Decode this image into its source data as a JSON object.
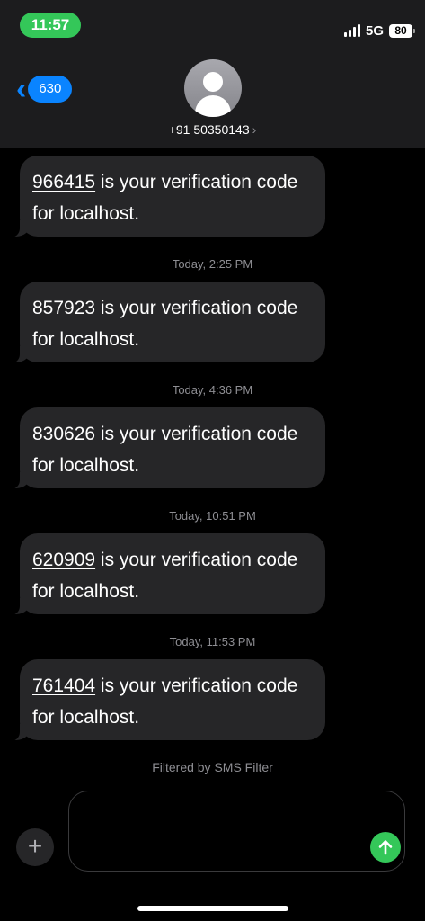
{
  "status_bar": {
    "time": "11:57",
    "network": "5G",
    "battery": "80"
  },
  "header": {
    "back_count": "630",
    "contact": "+91 50350143",
    "chevron": "›"
  },
  "messages": [
    {
      "code": "966415",
      "text": " is your verification code for localhost."
    },
    {
      "code": "857923",
      "text": " is your verification code for localhost."
    },
    {
      "code": "830626",
      "text": " is your verification code for localhost."
    },
    {
      "code": "620909",
      "text": " is your verification code for localhost."
    },
    {
      "code": "761404",
      "text": " is your verification code for localhost."
    }
  ],
  "timestamps": [
    "Today, 2:25 PM",
    "Today, 4:36 PM",
    "Today, 10:51 PM",
    "Today, 11:53 PM"
  ],
  "filter_note": "Filtered by SMS Filter",
  "composer": {
    "plus": "+",
    "placeholder": ""
  },
  "colors": {
    "accent": "#0a84ff",
    "send": "#34c759",
    "bubble": "#262628",
    "header": "#1c1c1e"
  }
}
